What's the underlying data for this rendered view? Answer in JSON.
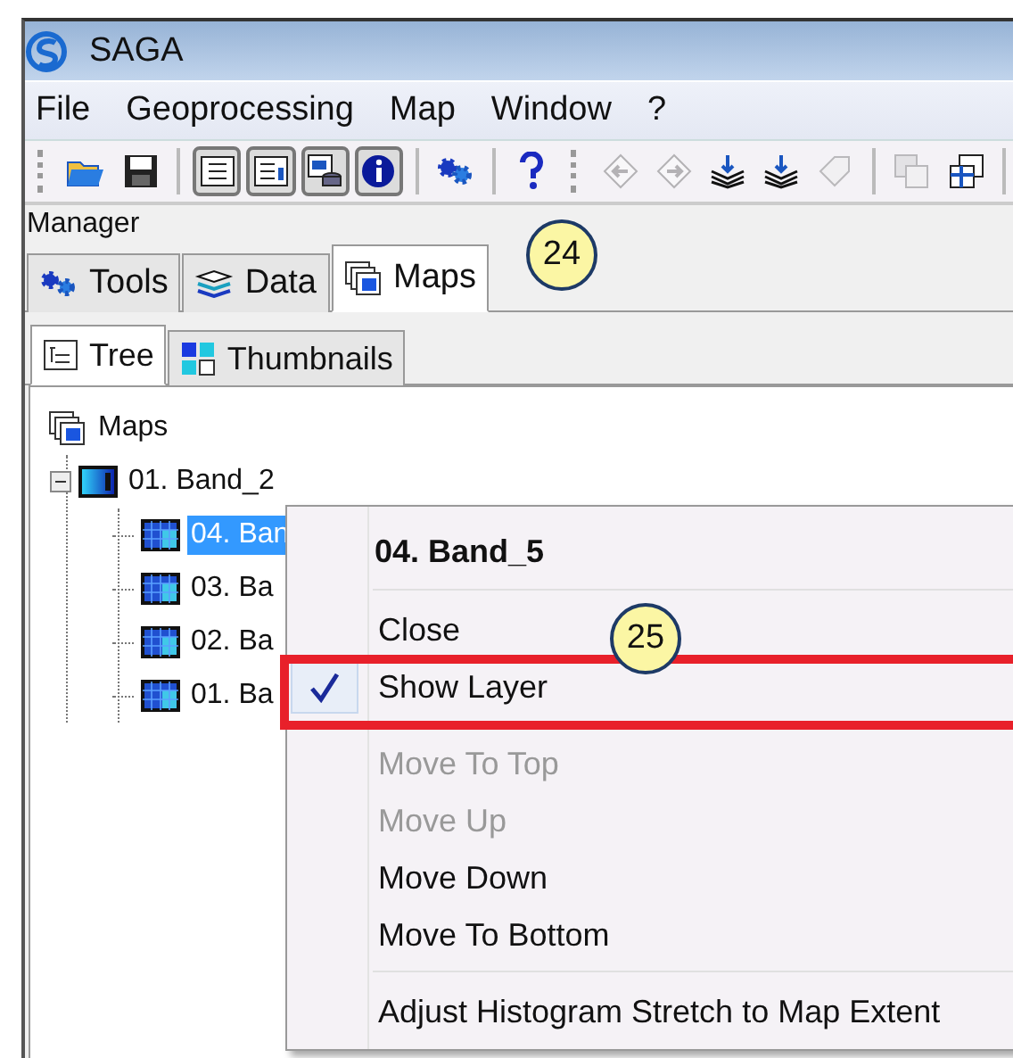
{
  "window": {
    "title": "SAGA"
  },
  "menu_bar": [
    "File",
    "Geoprocessing",
    "Map",
    "Window",
    "?"
  ],
  "toolbar": [
    {
      "pressed": false,
      "disabled": false
    },
    {
      "pressed": false,
      "disabled": false
    },
    {
      "kind": "separator"
    },
    {
      "pressed": true,
      "disabled": false
    },
    {
      "pressed": true,
      "disabled": false
    },
    {
      "pressed": true,
      "disabled": false
    },
    {
      "pressed": true,
      "disabled": false
    },
    {
      "kind": "separator"
    },
    {
      "pressed": false,
      "disabled": false
    },
    {
      "kind": "separator"
    },
    {
      "pressed": false,
      "disabled": false
    },
    {
      "kind": "grip"
    },
    {
      "pressed": false,
      "disabled": true
    },
    {
      "pressed": false,
      "disabled": true
    },
    {
      "pressed": false,
      "disabled": false
    },
    {
      "pressed": false,
      "disabled": false
    },
    {
      "pressed": false,
      "disabled": true
    },
    {
      "kind": "separator"
    },
    {
      "pressed": false,
      "disabled": true
    },
    {
      "pressed": false,
      "disabled": false
    },
    {
      "kind": "separator"
    }
  ],
  "manager": {
    "title": "Manager",
    "tabs": [
      {
        "label": "Tools",
        "selected": false
      },
      {
        "label": "Data",
        "selected": false
      },
      {
        "label": "Maps",
        "selected": true
      }
    ],
    "subtabs": [
      {
        "label": "Tree",
        "selected": true
      },
      {
        "label": "Thumbnails",
        "selected": false
      }
    ],
    "tree": [
      {
        "label": "Maps",
        "kind": "maps",
        "children": [
          {
            "label": "01. Band_2",
            "kind": "map",
            "expanded": true,
            "children": [
              {
                "label": "04. Ban",
                "kind": "grid",
                "selected": true
              },
              {
                "label": "03. Ba",
                "kind": "grid",
                "selected": false
              },
              {
                "label": "02. Ba",
                "kind": "grid",
                "selected": false
              },
              {
                "label": "01. Ba",
                "kind": "grid",
                "selected": false
              }
            ]
          }
        ]
      }
    ]
  },
  "context_menu": {
    "title": "04. Band_5",
    "items": [
      {
        "kind": "separator"
      },
      {
        "kind": "item",
        "label": "Close",
        "checked": false,
        "disabled": false,
        "outlined": false
      },
      {
        "kind": "item",
        "label": "Show Layer",
        "checked": true,
        "disabled": false,
        "outlined": true
      },
      {
        "kind": "separator"
      },
      {
        "kind": "item",
        "label": "Move To Top",
        "checked": false,
        "disabled": true,
        "outlined": false
      },
      {
        "kind": "item",
        "label": "Move Up",
        "checked": false,
        "disabled": true,
        "outlined": false
      },
      {
        "kind": "item",
        "label": "Move Down",
        "checked": false,
        "disabled": false,
        "outlined": false
      },
      {
        "kind": "item",
        "label": "Move To Bottom",
        "checked": false,
        "disabled": false,
        "outlined": false
      },
      {
        "kind": "separator"
      },
      {
        "kind": "item",
        "label": "Adjust Histogram Stretch to Map Extent",
        "checked": false,
        "disabled": false,
        "outlined": false
      }
    ]
  },
  "callouts": [
    "24",
    "25"
  ]
}
